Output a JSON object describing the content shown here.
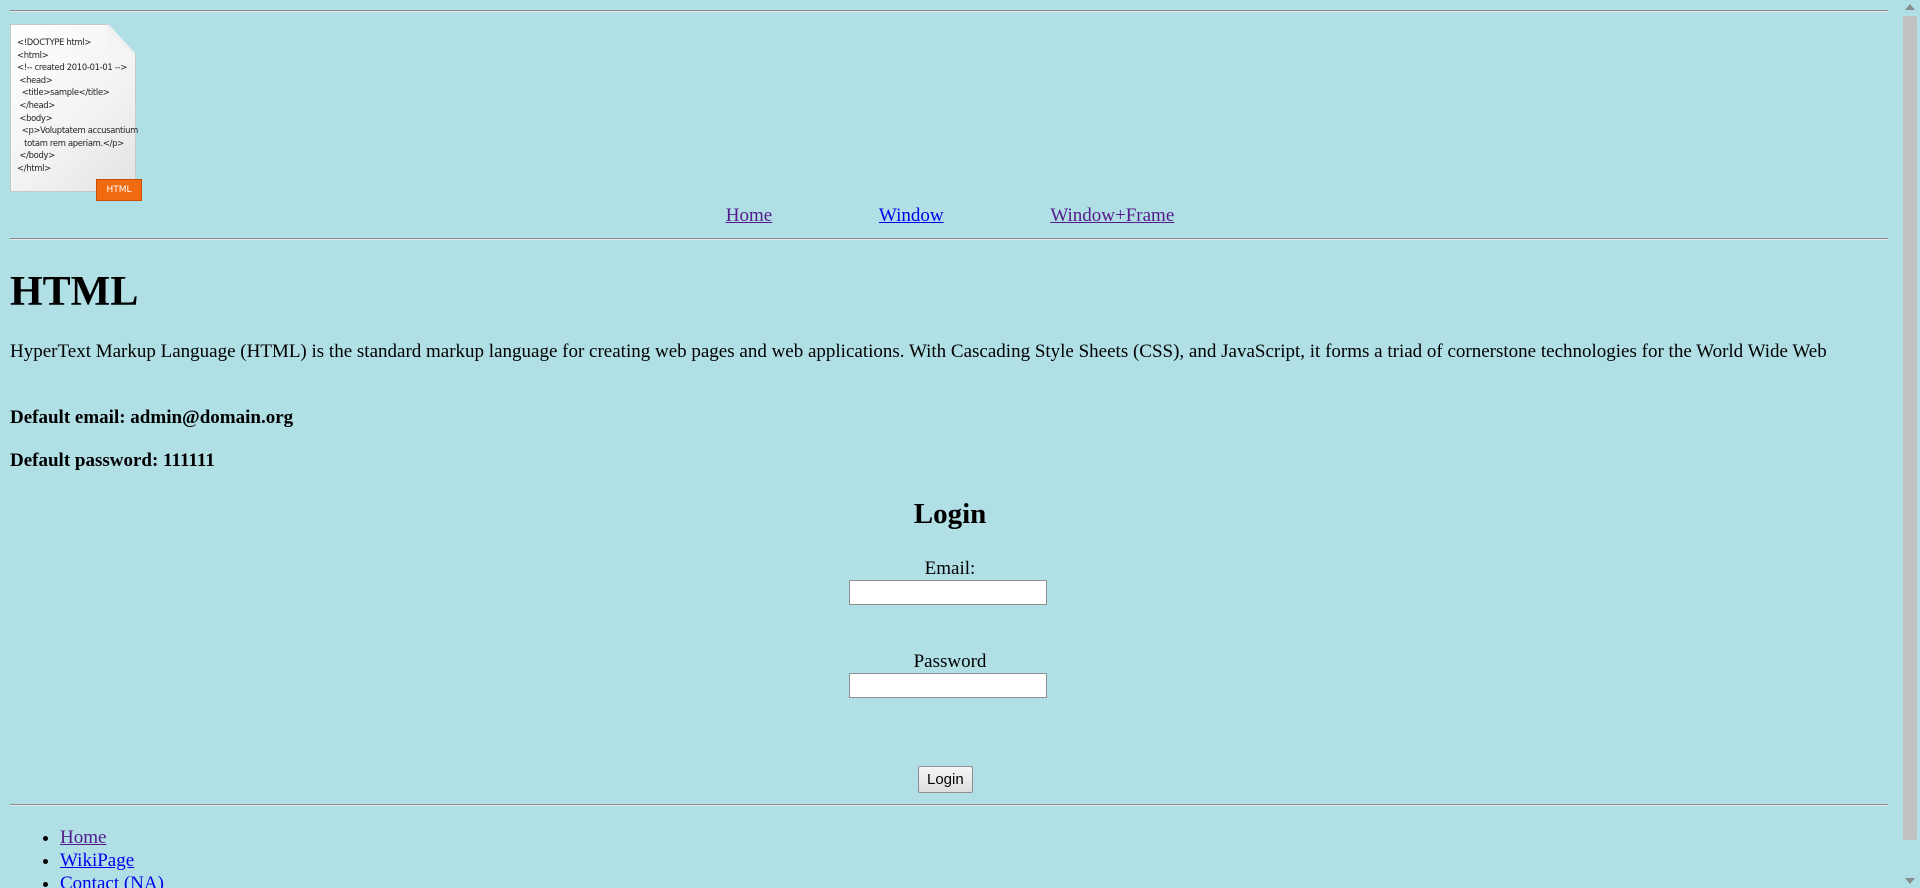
{
  "logo": {
    "code_lines": [
      "<!DOCTYPE html>",
      "<html>",
      "<!-- created 2010-01-01 -->",
      " <head>",
      "  <title>sample</title>",
      " </head>",
      " <body>",
      "  <p>Voluptatem accusantium",
      "   totam rem aperiam.</p>",
      " </body>",
      "</html>"
    ],
    "tag_label": "HTML"
  },
  "top_nav": {
    "home": "Home",
    "window": "Window",
    "window_frame": "Window+Frame"
  },
  "main": {
    "title": "HTML",
    "intro": "HyperText Markup Language (HTML) is the standard markup language for creating web pages and web applications. With Cascading Style Sheets (CSS), and JavaScript, it forms a triad of cornerstone technologies for the World Wide Web",
    "default_email": "Default email: admin@domain.org",
    "default_password": "Default password: 111111"
  },
  "login": {
    "heading": "Login",
    "email_label": "Email:",
    "email_value": "",
    "password_label": "Password",
    "password_value": "",
    "button_label": "Login"
  },
  "footer_links": {
    "home": "Home",
    "wiki": "WikiPage",
    "contact": "Contact (NA)"
  },
  "colors": {
    "background": "#b0dfe5",
    "visited_link": "#551a8b",
    "link": "#0000ee",
    "html_tag": "#f26a10"
  }
}
